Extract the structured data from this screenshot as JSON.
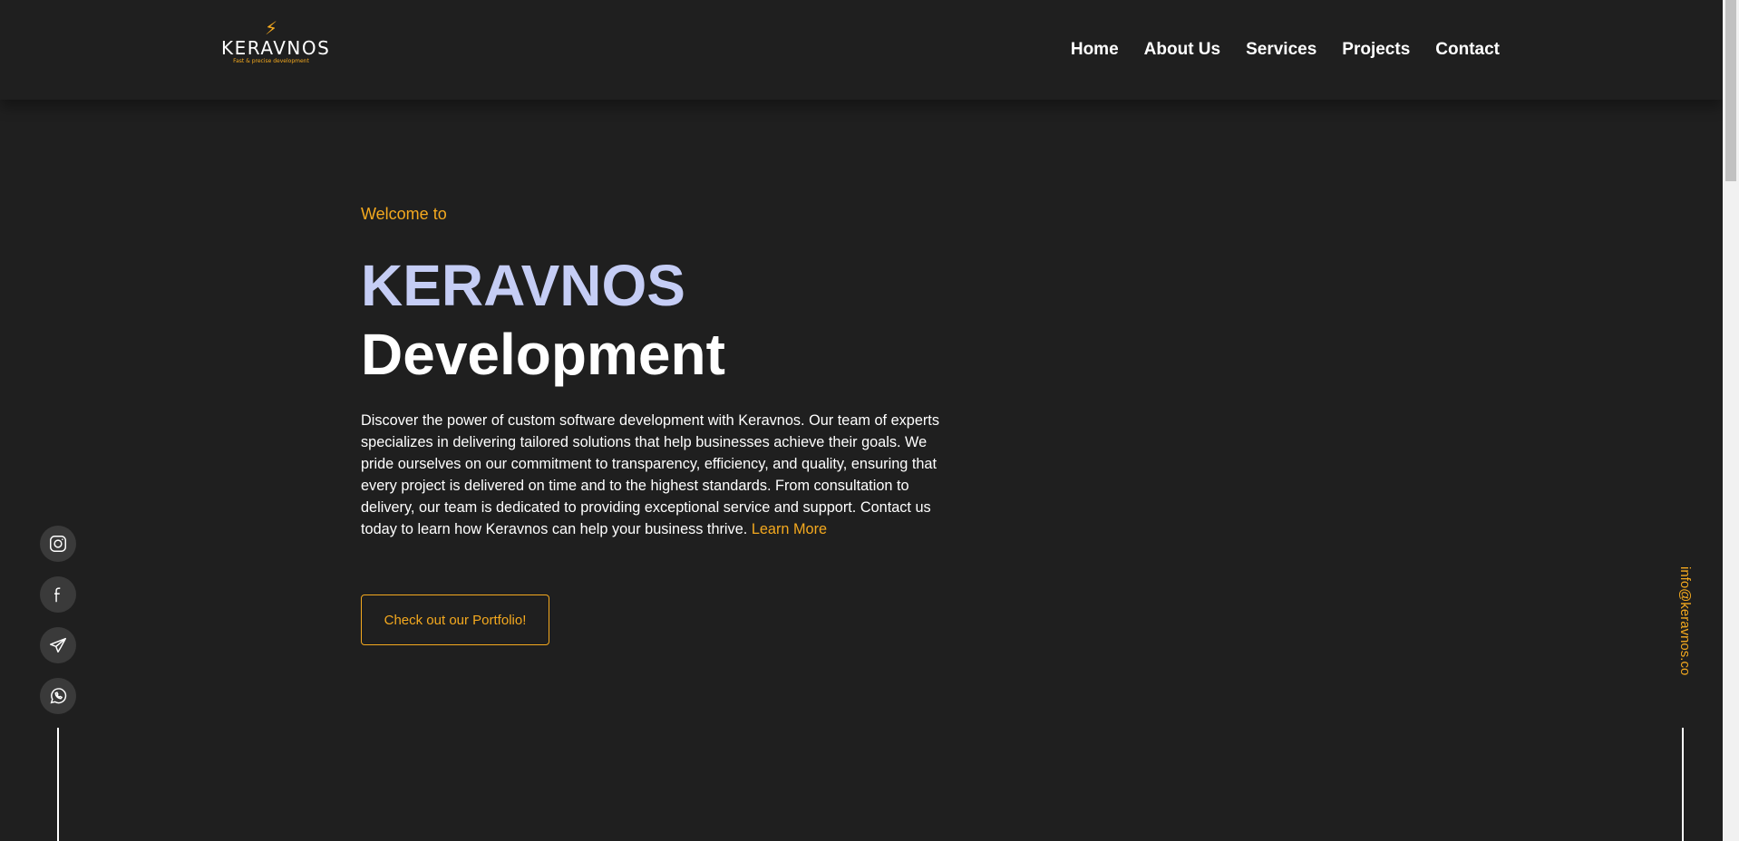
{
  "header": {
    "logo": {
      "name": "KERAVNOS",
      "tagline": "Fast & precise development"
    },
    "nav": [
      "Home",
      "About Us",
      "Services",
      "Projects",
      "Contact"
    ]
  },
  "hero": {
    "welcome": "Welcome to",
    "title_line1": "KERAVNOS",
    "title_line2": "Development",
    "description": "Discover the power of custom software development with Keravnos. Our team of experts specializes in delivering tailored solutions that help businesses achieve their goals. We pride ourselves on our commitment to transparency, efficiency, and quality, ensuring that every project is delivered on time and to the highest standards. From consultation to delivery, our team is dedicated to providing exceptional service and support. Contact us today to learn how Keravnos can help your business thrive.",
    "learn_more": "Learn More",
    "cta": "Check out our Portfolio!"
  },
  "social": [
    "instagram-icon",
    "facebook-icon",
    "telegram-icon",
    "whatsapp-icon"
  ],
  "contact_email": "info@keravnos.co",
  "colors": {
    "background": "#1f1f1f",
    "accent": "#f4a91f",
    "title_highlight": "#c5cdf5",
    "social_bg": "#3a3a3a"
  }
}
